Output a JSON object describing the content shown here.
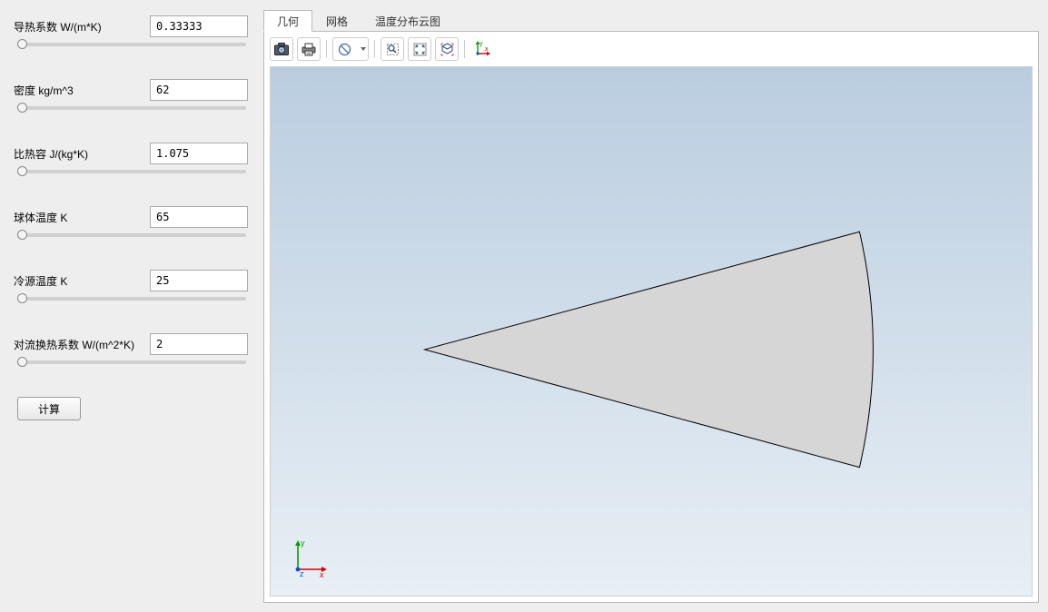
{
  "params": [
    {
      "label": "导热系数 W/(m*K)",
      "value": "0.33333"
    },
    {
      "label": "密度 kg/m^3",
      "value": "62"
    },
    {
      "label": "比热容 J/(kg*K)",
      "value": "1.075"
    },
    {
      "label": "球体温度 K",
      "value": "65"
    },
    {
      "label": "冷源温度 K",
      "value": "25"
    },
    {
      "label": "对流换热系数 W/(m^2*K)",
      "value": "2"
    }
  ],
  "buttons": {
    "compute": "计算"
  },
  "tabs": [
    {
      "label": "几何",
      "active": true
    },
    {
      "label": "网格",
      "active": false
    },
    {
      "label": "温度分布云图",
      "active": false
    }
  ],
  "toolbar_icons": {
    "snapshot": "snapshot-icon",
    "print": "print-icon",
    "scene_light": "scene-light-icon",
    "zoom_box": "zoom-box-icon",
    "zoom_extents": "zoom-extents-icon",
    "zoom_selected": "zoom-selected-icon"
  },
  "axis_labels": {
    "x": "x",
    "y": "y",
    "z": "z"
  }
}
